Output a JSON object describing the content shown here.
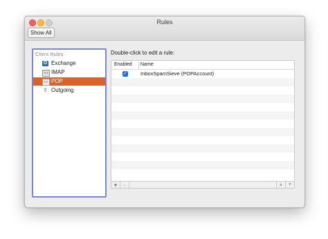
{
  "window": {
    "title": "Rules"
  },
  "toolbar": {
    "show_all_label": "Show All"
  },
  "sidebar": {
    "header": "Client Rules",
    "items": [
      {
        "label": "Exchange",
        "icon": "exchange-icon",
        "selected": false
      },
      {
        "label": "IMAP",
        "icon": "imap-icon",
        "selected": false
      },
      {
        "label": "POP",
        "icon": "pop-icon",
        "selected": true
      },
      {
        "label": "Outgoing",
        "icon": "outgoing-icon",
        "selected": false
      }
    ]
  },
  "main": {
    "hint": "Double-click to edit a rule:",
    "table": {
      "columns": [
        "Enabled",
        "Name"
      ],
      "rows": [
        {
          "enabled": true,
          "name": "InboxSpamSieve (POPAccount)"
        }
      ]
    },
    "footer": {
      "add_label": "+",
      "remove_label": "−",
      "up_label": "▲",
      "down_label": "▼"
    }
  },
  "colors": {
    "selection": "#d9632c",
    "sidebar_focus": "#7a86d4",
    "checkbox": "#1f6fe0"
  }
}
